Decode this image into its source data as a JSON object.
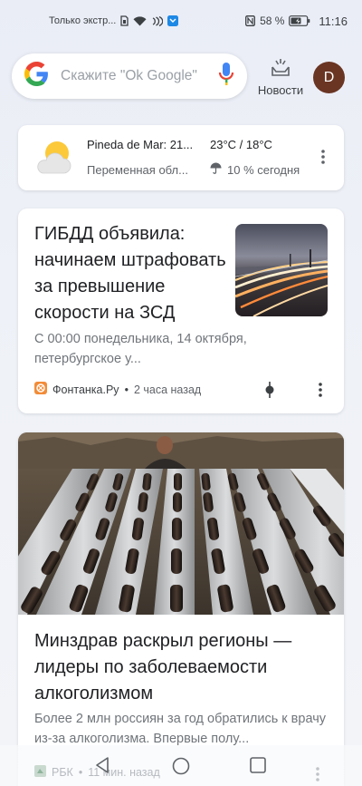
{
  "status_bar": {
    "carrier": "Только экстр...",
    "battery_percent": "58 %",
    "time": "11:16",
    "icons": [
      "sim-icon",
      "wifi-icon",
      "nfc-icon",
      "vk-app-icon",
      "battery-icon"
    ]
  },
  "search": {
    "placeholder": "Скажите \"Ok Google\"",
    "icons": [
      "google-logo-icon",
      "microphone-icon"
    ]
  },
  "news_button": {
    "label": "Новости",
    "icon": "news-tray-icon"
  },
  "avatar": {
    "initial": "D"
  },
  "weather": {
    "location": "Pineda de Mar: 21...",
    "condition": "Переменная обл...",
    "temperature": "23°C / 18°C",
    "rain": "10 % сегодня",
    "icons": [
      "partly-cloudy-icon",
      "umbrella-icon",
      "more-vert-icon"
    ]
  },
  "articles": [
    {
      "title": "ГИБДД объявила: начинаем штрафовать за превышение скорости на ЗСД",
      "snippet": "С 00:00 понедельника, 14 октября, петербургское у...",
      "source": "Фонтанка.Ру",
      "time": "2 часа назад",
      "separator": "•",
      "thumbnail": "highway-light-trails"
    },
    {
      "title": "Минздрав раскрыл регионы — лидеры по заболеваемости алкоголизмом",
      "snippet": "Более 2 млн россиян за год обратились к врачу из-за алкоголизма. Впервые полу...",
      "source": "РБК",
      "time": "11 мин. назад",
      "separator": "•",
      "image": "empty-bottles-pile"
    }
  ],
  "colors": {
    "google_blue": "#4285F4",
    "google_red": "#EA4335",
    "google_yellow": "#FBBC05",
    "google_green": "#34A853",
    "avatar_bg": "#6A3523"
  }
}
